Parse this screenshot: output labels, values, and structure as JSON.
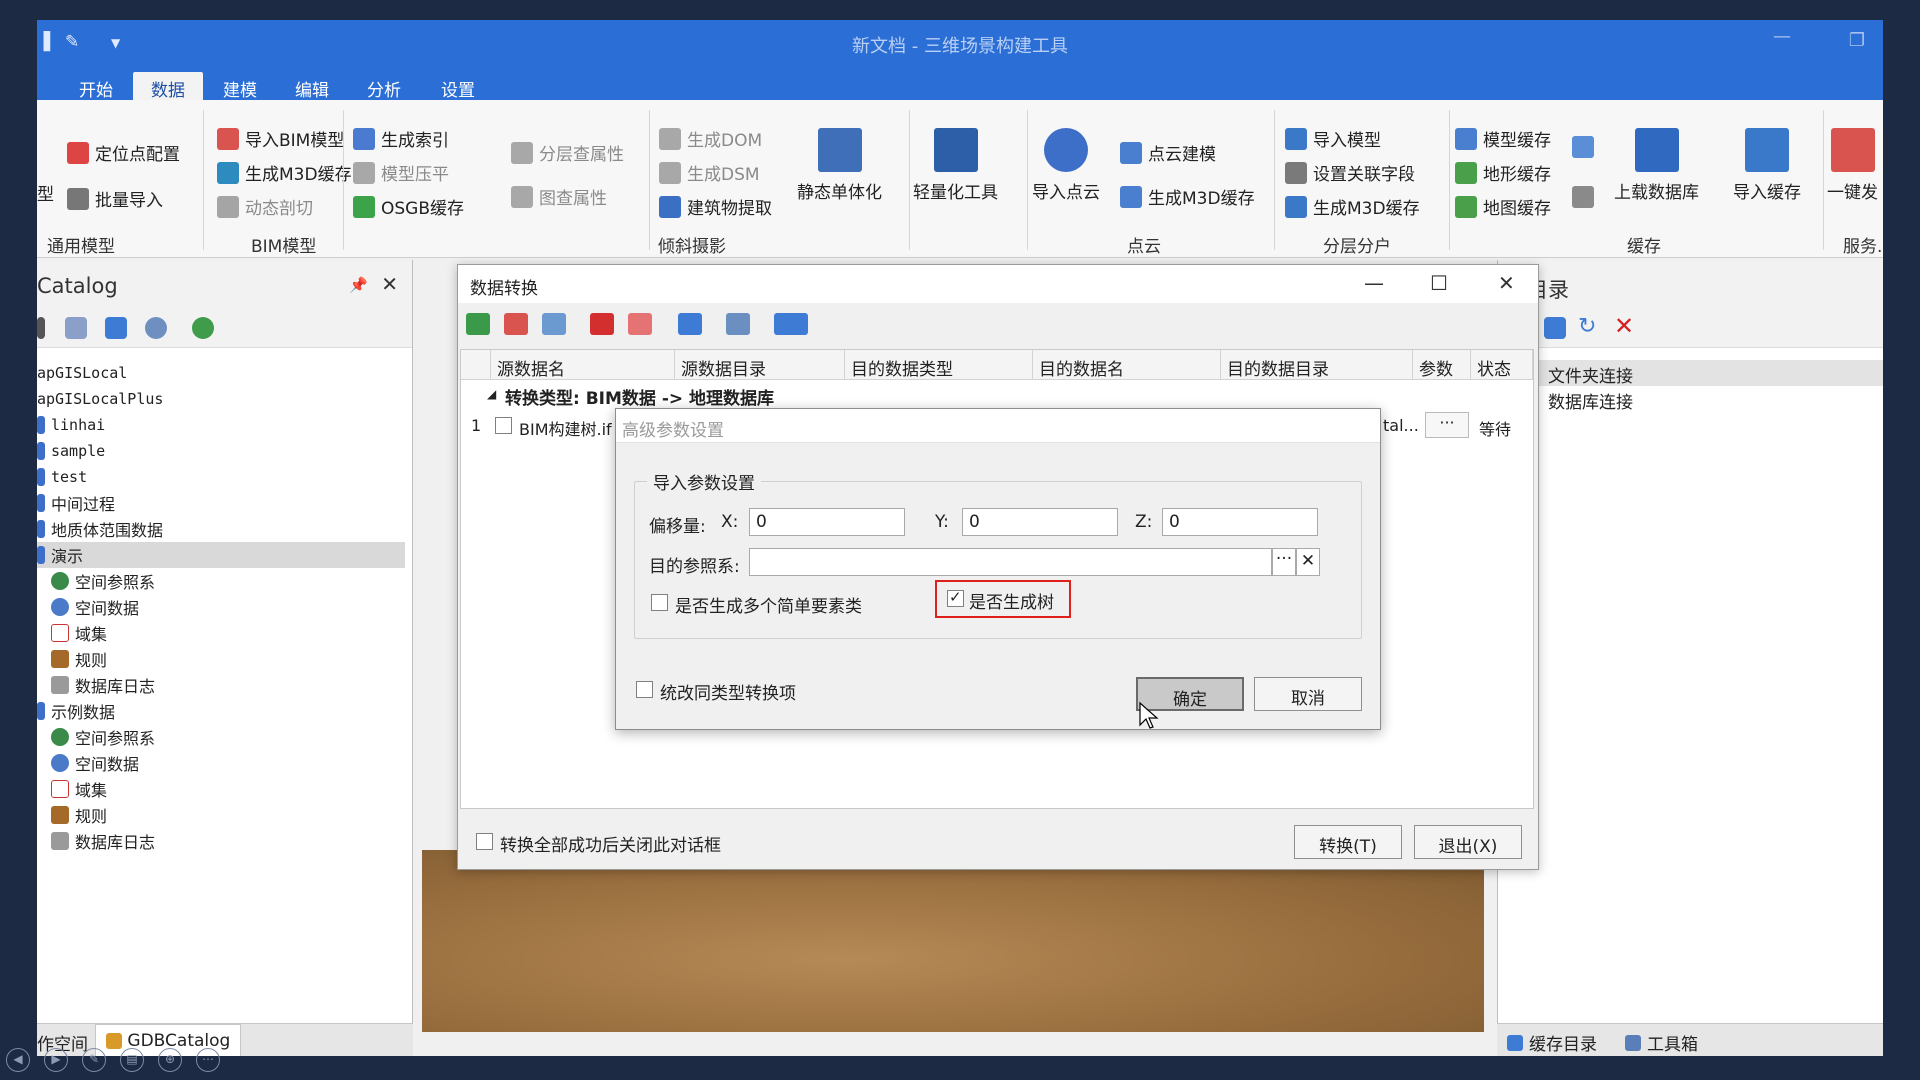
{
  "window": {
    "title": "新文档 - 三维场景构建工具"
  },
  "tabs": [
    "开始",
    "数据",
    "建模",
    "编辑",
    "分析",
    "设置"
  ],
  "ribbon": {
    "general": {
      "items": [
        "定位点配置",
        "批量导入"
      ],
      "partial": "型",
      "group": "通用模型"
    },
    "bim": {
      "items": [
        "导入BIM模型",
        "生成M3D缓存",
        "动态剖切"
      ],
      "group": "BIM模型"
    },
    "oblique": {
      "col1": [
        "生成索引",
        "模型压平",
        "OSGB缓存"
      ],
      "col2": [
        "分层查属性",
        "图查属性"
      ],
      "col3": [
        "生成DOM",
        "生成DSM",
        "建筑物提取"
      ],
      "big1": "静态单体化",
      "big2": "轻量化工具",
      "group": "倾斜摄影"
    },
    "pointcloud": {
      "big": "导入点云",
      "items": [
        "点云建模",
        "生成M3D缓存"
      ],
      "group": "点云"
    },
    "layered": {
      "items": [
        "导入模型",
        "设置关联字段",
        "生成M3D缓存"
      ],
      "group": "分层分户"
    },
    "cache": {
      "items": [
        "模型缓存",
        "地形缓存",
        "地图缓存"
      ],
      "big1": "上载数据库",
      "big2": "导入缓存",
      "group": "缓存"
    },
    "service": {
      "big": "一键发",
      "group": "服务.."
    }
  },
  "catalog": {
    "title": "Catalog",
    "nodes": [
      "apGISLocal",
      "apGISLocalPlus",
      "linhai",
      "sample",
      "test",
      "中间过程",
      "地质体范围数据",
      "演示",
      "空间参照系",
      "空间数据",
      "域集",
      "规则",
      "数据库日志",
      "示例数据",
      "空间参照系",
      "空间数据",
      "域集",
      "规则",
      "数据库日志"
    ],
    "bottom_tabs": [
      "作空间",
      "GDBCatalog"
    ]
  },
  "cachepanel": {
    "title": "存目录",
    "items": [
      "文件夹连接",
      "数据库连接"
    ],
    "bottom_tabs": [
      "缓存目录",
      "工具箱"
    ]
  },
  "convert_dialog": {
    "title": "数据转换",
    "columns": [
      "源数据名",
      "源数据目录",
      "目的数据类型",
      "目的数据名",
      "目的数据目录",
      "参数",
      "状态"
    ],
    "group_row": "转换类型: BIM数据 -> 地理数据库",
    "row": {
      "index": "1",
      "source_name": "BIM构建树.if",
      "dest_dir": "tal...",
      "param": "···",
      "status": "等待"
    },
    "close_checkbox": "转换全部成功后关闭此对话框",
    "convert_button": "转换(T)",
    "exit_button": "退出(X)"
  },
  "adv_dialog": {
    "title": "高级参数设置",
    "section": "导入参数设置",
    "offset_label": "偏移量:",
    "x_label": "X:",
    "x_value": "0",
    "y_label": "Y:",
    "y_value": "0",
    "z_label": "Z:",
    "z_value": "0",
    "ref_label": "目的参照系:",
    "ref_value": "",
    "multi_checkbox": "是否生成多个简单要素类",
    "tree_checkbox": "是否生成树",
    "tree_checked": true,
    "same_type_checkbox": "统改同类型转换项",
    "ok_button": "确定",
    "cancel_button": "取消"
  },
  "colors": {
    "titlebar": "#2b6fd6",
    "highlight": "#e0201a"
  }
}
